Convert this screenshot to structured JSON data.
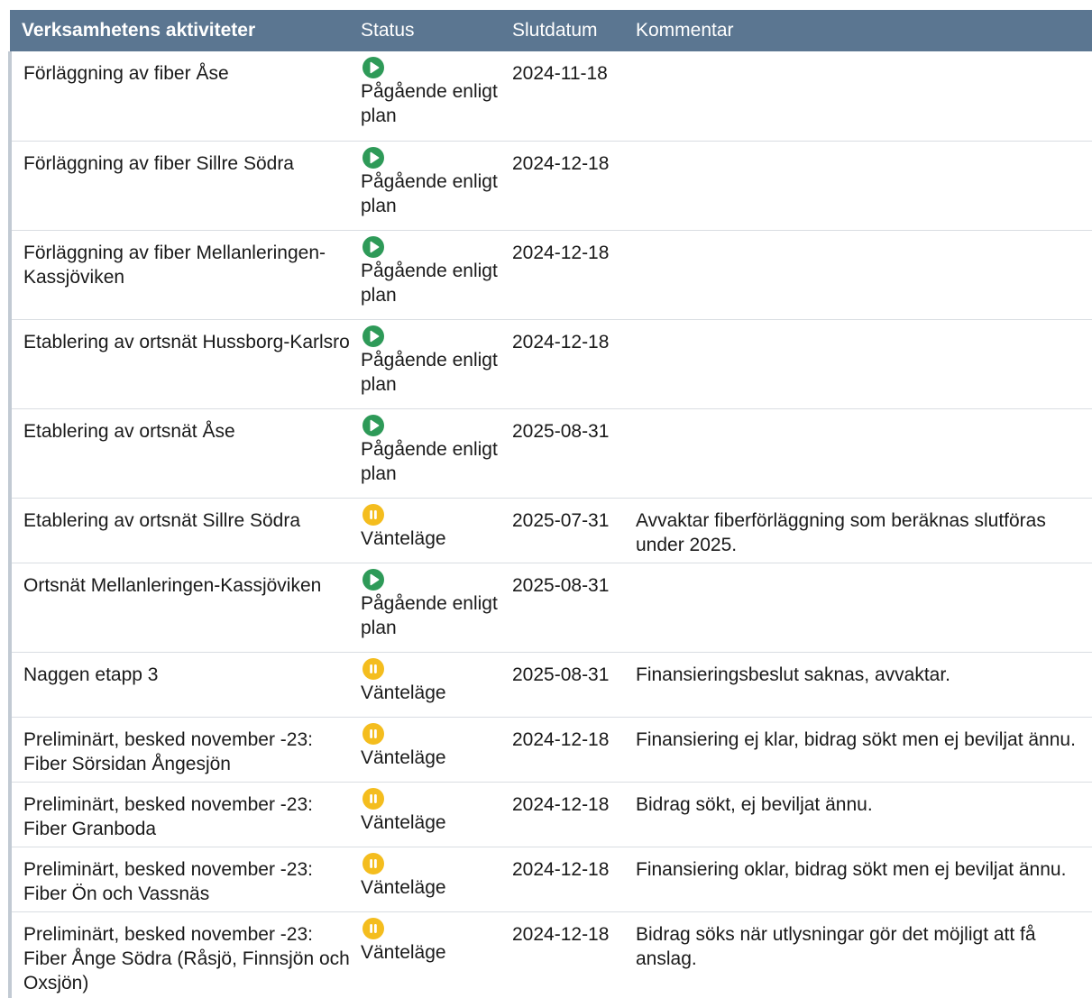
{
  "header": {
    "activity": "Verksamhetens aktiviteter",
    "status": "Status",
    "end_date": "Slutdatum",
    "comment": "Kommentar"
  },
  "colors": {
    "header_bg": "#5b7691",
    "ongoing": "#2e9a58",
    "waiting": "#f4bd1e"
  },
  "rows": [
    {
      "activity": "Förläggning av fiber Åse",
      "status": "Pågående enligt plan",
      "status_icon": "play-icon",
      "date": "2024-11-18",
      "comment": ""
    },
    {
      "activity": "Förläggning av fiber Sillre Södra",
      "status": "Pågående enligt plan",
      "status_icon": "play-icon",
      "date": "2024-12-18",
      "comment": ""
    },
    {
      "activity": "Förläggning av fiber Mellanleringen-Kassjöviken",
      "status": "Pågående enligt plan",
      "status_icon": "play-icon",
      "date": "2024-12-18",
      "comment": ""
    },
    {
      "activity": "Etablering av ortsnät Hussborg-Karlsro",
      "status": "Pågående enligt plan",
      "status_icon": "play-icon",
      "date": "2024-12-18",
      "comment": ""
    },
    {
      "activity": "Etablering av ortsnät Åse",
      "status": "Pågående enligt plan",
      "status_icon": "play-icon",
      "date": "2025-08-31",
      "comment": ""
    },
    {
      "activity": "Etablering av ortsnät Sillre Södra",
      "status": "Vänteläge",
      "status_icon": "pause-icon",
      "date": "2025-07-31",
      "comment": "Avvaktar fiberförläggning som beräknas slutföras under 2025."
    },
    {
      "activity": "Ortsnät Mellanleringen-Kassjöviken",
      "status": "Pågående enligt plan",
      "status_icon": "play-icon",
      "date": "2025-08-31",
      "comment": ""
    },
    {
      "activity": "Naggen etapp 3",
      "status": "Vänteläge",
      "status_icon": "pause-icon",
      "date": "2025-08-31",
      "comment": "Finansieringsbeslut saknas, avvaktar."
    },
    {
      "activity": "Preliminärt, besked november -23: Fiber Sörsidan Ångesjön",
      "status": "Vänteläge",
      "status_icon": "pause-icon",
      "date": "2024-12-18",
      "comment": "Finansiering ej klar, bidrag sökt men ej beviljat ännu."
    },
    {
      "activity": "Preliminärt, besked november -23: Fiber Granboda",
      "status": "Vänteläge",
      "status_icon": "pause-icon",
      "date": "2024-12-18",
      "comment": "Bidrag sökt, ej beviljat ännu."
    },
    {
      "activity": "Preliminärt, besked november -23: Fiber Ön och Vassnäs",
      "status": "Vänteläge",
      "status_icon": "pause-icon",
      "date": "2024-12-18",
      "comment": "Finansiering oklar, bidrag sökt men ej beviljat ännu."
    },
    {
      "activity": "Preliminärt, besked november -23: Fiber Ånge Södra (Råsjö, Finnsjön och Oxsjön)",
      "status": "Vänteläge",
      "status_icon": "pause-icon",
      "date": "2024-12-18",
      "comment": "Bidrag söks när utlysningar gör det möjligt att få anslag."
    }
  ]
}
